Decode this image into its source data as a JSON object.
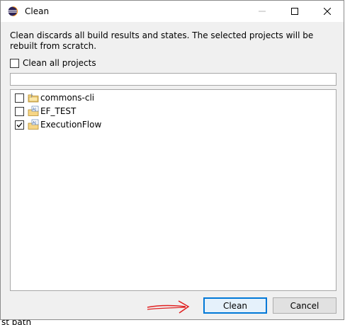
{
  "window": {
    "title": "Clean",
    "description": "Clean discards all build results and states. The selected projects will be rebuilt from scratch.",
    "clean_all": {
      "label": "Clean all projects",
      "checked": false
    },
    "filter": {
      "value": ""
    },
    "projects": [
      {
        "name": "commons-cli",
        "checked": false,
        "icon": "java-project-icon"
      },
      {
        "name": "EF_TEST",
        "checked": false,
        "icon": "aspectj-project-icon"
      },
      {
        "name": "ExecutionFlow",
        "checked": true,
        "icon": "aspectj-project-icon"
      }
    ],
    "buttons": {
      "clean": "Clean",
      "cancel": "Cancel"
    }
  },
  "background": {
    "partial_text": "st path"
  },
  "colors": {
    "primary_button_border": "#0078d7",
    "annotation_arrow": "#e02020"
  }
}
